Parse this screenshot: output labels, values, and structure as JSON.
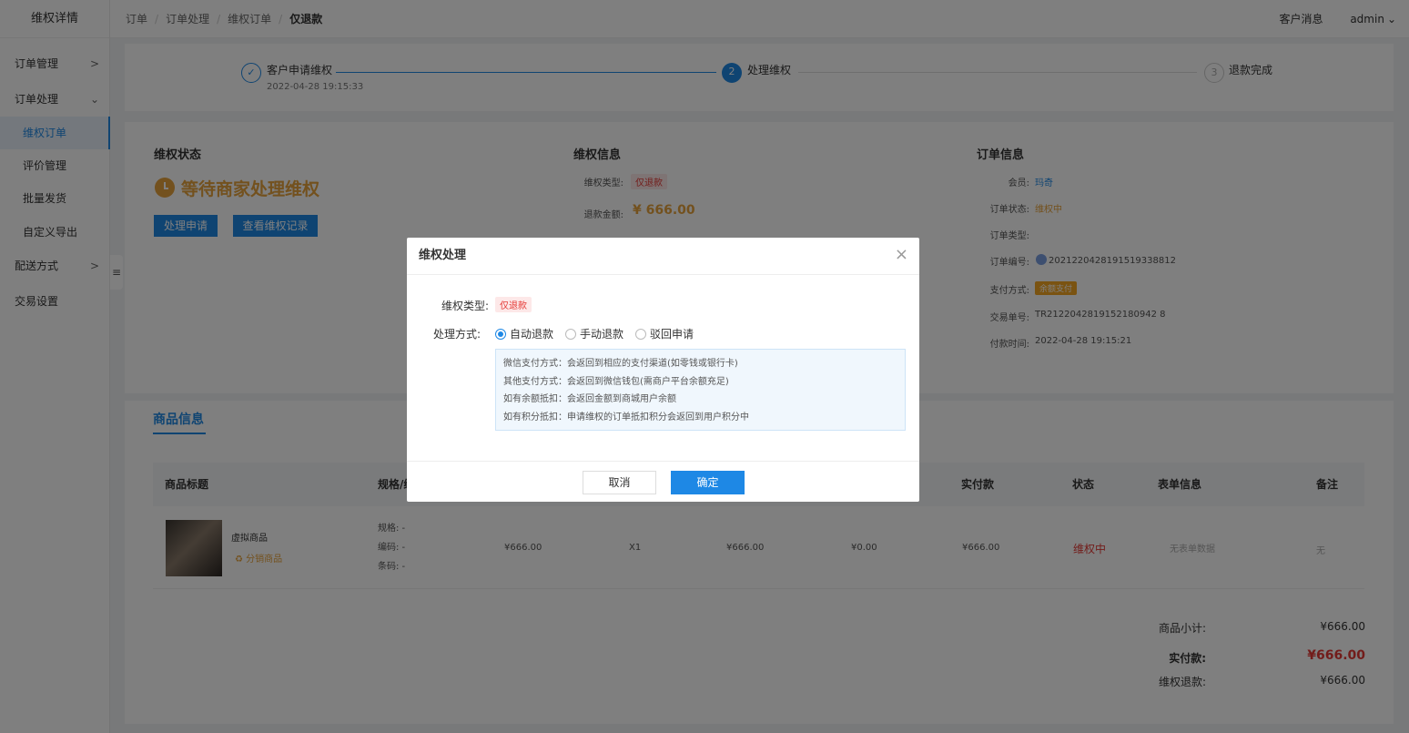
{
  "sidebar": {
    "brand": "维权详情",
    "items": [
      {
        "label": "订单管理",
        "arrow": ">"
      },
      {
        "label": "订单处理",
        "arrow": "⌄"
      },
      {
        "label": "维权订单"
      },
      {
        "label": "评价管理"
      },
      {
        "label": "批量发货"
      },
      {
        "label": "自定义导出"
      },
      {
        "label": "配送方式",
        "arrow": ">"
      },
      {
        "label": "交易设置"
      }
    ],
    "collapse_glyph": "≡"
  },
  "header": {
    "breadcrumb": [
      "订单",
      "订单处理",
      "维权订单",
      "仅退款"
    ],
    "separator": "/",
    "messages": "客户消息",
    "user": "admin"
  },
  "steps": [
    {
      "label": "客户申请维权",
      "date": "2022-04-28 19:15:33",
      "mark": "✓"
    },
    {
      "label": "处理维权",
      "mark": "2"
    },
    {
      "label": "退款完成",
      "mark": "3"
    }
  ],
  "status": {
    "title": "维权状态",
    "text": "等待商家处理维权",
    "btn_handle": "处理申请",
    "btn_records": "查看维权记录"
  },
  "rights_info": {
    "title": "维权信息",
    "type_label": "维权类型:",
    "type_value": "仅退款",
    "amount_label": "退款金额:",
    "amount_value": "¥ 666.00"
  },
  "order_info": {
    "title": "订单信息",
    "rows": [
      {
        "label": "会员:",
        "value": "玛奇"
      },
      {
        "label": "订单状态:",
        "value": "维权中"
      },
      {
        "label": "订单类型:",
        "value": ""
      },
      {
        "label": "订单编号:",
        "value": "20212204281915193388 12"
      },
      {
        "label": "支付方式:",
        "value": "余额支付"
      },
      {
        "label": "交易单号:",
        "value": "TR2122042819152180942 8"
      },
      {
        "label": "付款时间:",
        "value": "2022-04-28 19:15:21"
      }
    ],
    "order_no": "2021220428191519338812",
    "trade_no": "TR2122042819152180942 8"
  },
  "goods": {
    "tab": "商品信息",
    "columns": [
      "商品标题",
      "规格/编码",
      "实付款",
      "状态",
      "表单信息",
      "备注"
    ],
    "row": {
      "name": "虚拟商品",
      "badge": "分销商品",
      "spec": "规格: -",
      "code": "编码: -",
      "barcode": "条码: -",
      "price": "¥666.00",
      "qty": "X1",
      "total": "¥666.00",
      "discount": "¥0.00",
      "paid": "¥666.00",
      "status": "维权中",
      "form": "无表单数据",
      "remark": "无"
    },
    "summary": [
      {
        "label": "商品小计:",
        "value": "¥666.00"
      },
      {
        "label": "实付款:",
        "value": "¥666.00"
      },
      {
        "label": "维权退款:",
        "value": "¥666.00"
      }
    ]
  },
  "modal": {
    "title": "维权处理",
    "close": "×",
    "type_label": "维权类型:",
    "type_value": "仅退款",
    "method_label": "处理方式:",
    "options": [
      "自动退款",
      "手动退款",
      "驳回申请"
    ],
    "selected": "自动退款",
    "info": [
      "微信支付方式：会返回到相应的支付渠道(如零钱或银行卡)",
      "其他支付方式：会返回到微信钱包(需商户平台余额充足)",
      "如有余额抵扣：会返回金额到商城用户余额",
      "如有积分抵扣：申请维权的订单抵扣积分会返回到用户积分中"
    ],
    "cancel": "取消",
    "confirm": "确定"
  },
  "colors": {
    "accent": "#1e88e5",
    "warning": "#e6a23c",
    "danger": "#e53935"
  }
}
